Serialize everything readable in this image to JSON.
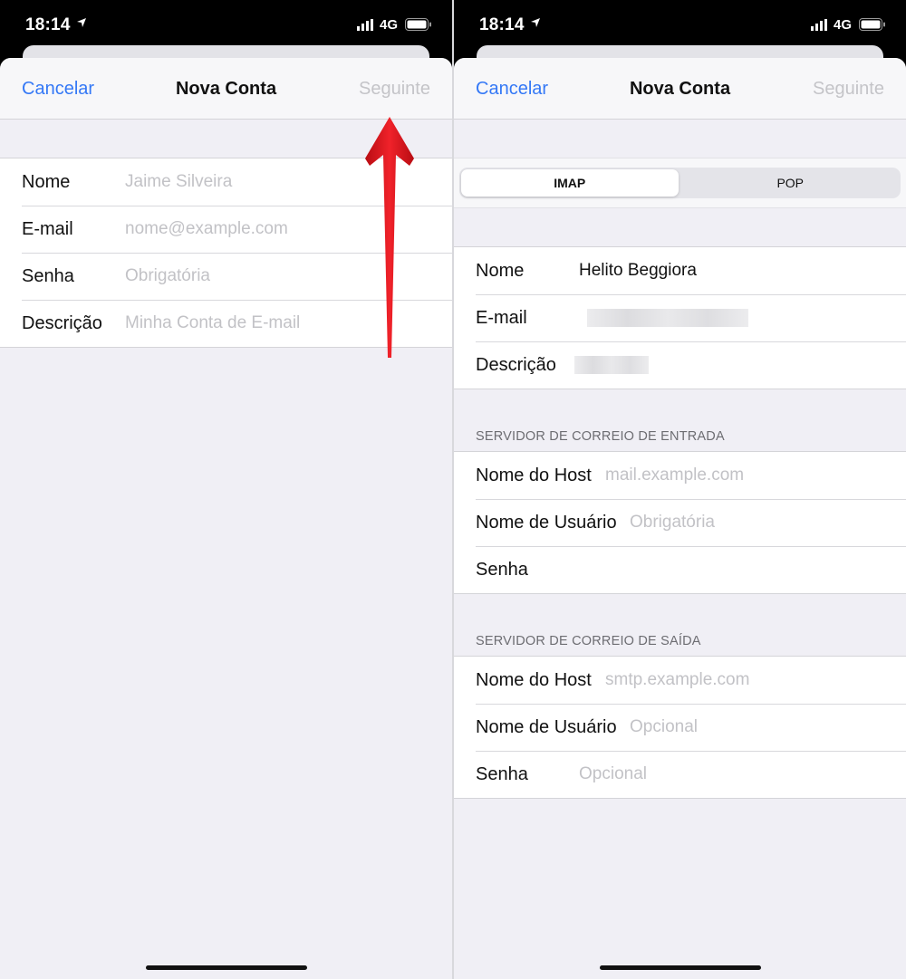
{
  "left": {
    "status": {
      "time": "18:14",
      "network": "4G"
    },
    "nav": {
      "cancel": "Cancelar",
      "title": "Nova Conta",
      "next": "Seguinte"
    },
    "fields": [
      {
        "label": "Nome",
        "placeholder": "Jaime Silveira"
      },
      {
        "label": "E-mail",
        "placeholder": "nome@example.com"
      },
      {
        "label": "Senha",
        "placeholder": "Obrigatória"
      },
      {
        "label": "Descrição",
        "placeholder": "Minha Conta de E-mail"
      }
    ]
  },
  "right": {
    "status": {
      "time": "18:14",
      "network": "4G"
    },
    "nav": {
      "cancel": "Cancelar",
      "title": "Nova Conta",
      "next": "Seguinte"
    },
    "segments": {
      "selected": "IMAP",
      "other": "POP"
    },
    "account": [
      {
        "label": "Nome",
        "value": "Helito Beggiora"
      },
      {
        "label": "E-mail",
        "value": ""
      },
      {
        "label": "Descrição",
        "value": ""
      }
    ],
    "incoming": {
      "header": "SERVIDOR DE CORREIO DE ENTRADA",
      "rows": [
        {
          "label": "Nome do Host",
          "placeholder": "mail.example.com"
        },
        {
          "label": "Nome de Usuário",
          "placeholder": "Obrigatória"
        },
        {
          "label": "Senha",
          "placeholder": ""
        }
      ]
    },
    "outgoing": {
      "header": "SERVIDOR DE CORREIO DE SAÍDA",
      "rows": [
        {
          "label": "Nome do Host",
          "placeholder": "smtp.example.com"
        },
        {
          "label": "Nome de Usuário",
          "placeholder": "Opcional"
        },
        {
          "label": "Senha",
          "placeholder": "Opcional"
        }
      ]
    }
  },
  "colors": {
    "accent": "#3478f6",
    "disabled": "#c4c4c8",
    "annotation_arrow": "#e8141b"
  },
  "icons": [
    "location-arrow-icon",
    "cellular-signal-icon",
    "battery-icon",
    "red-arrow-icon"
  ]
}
